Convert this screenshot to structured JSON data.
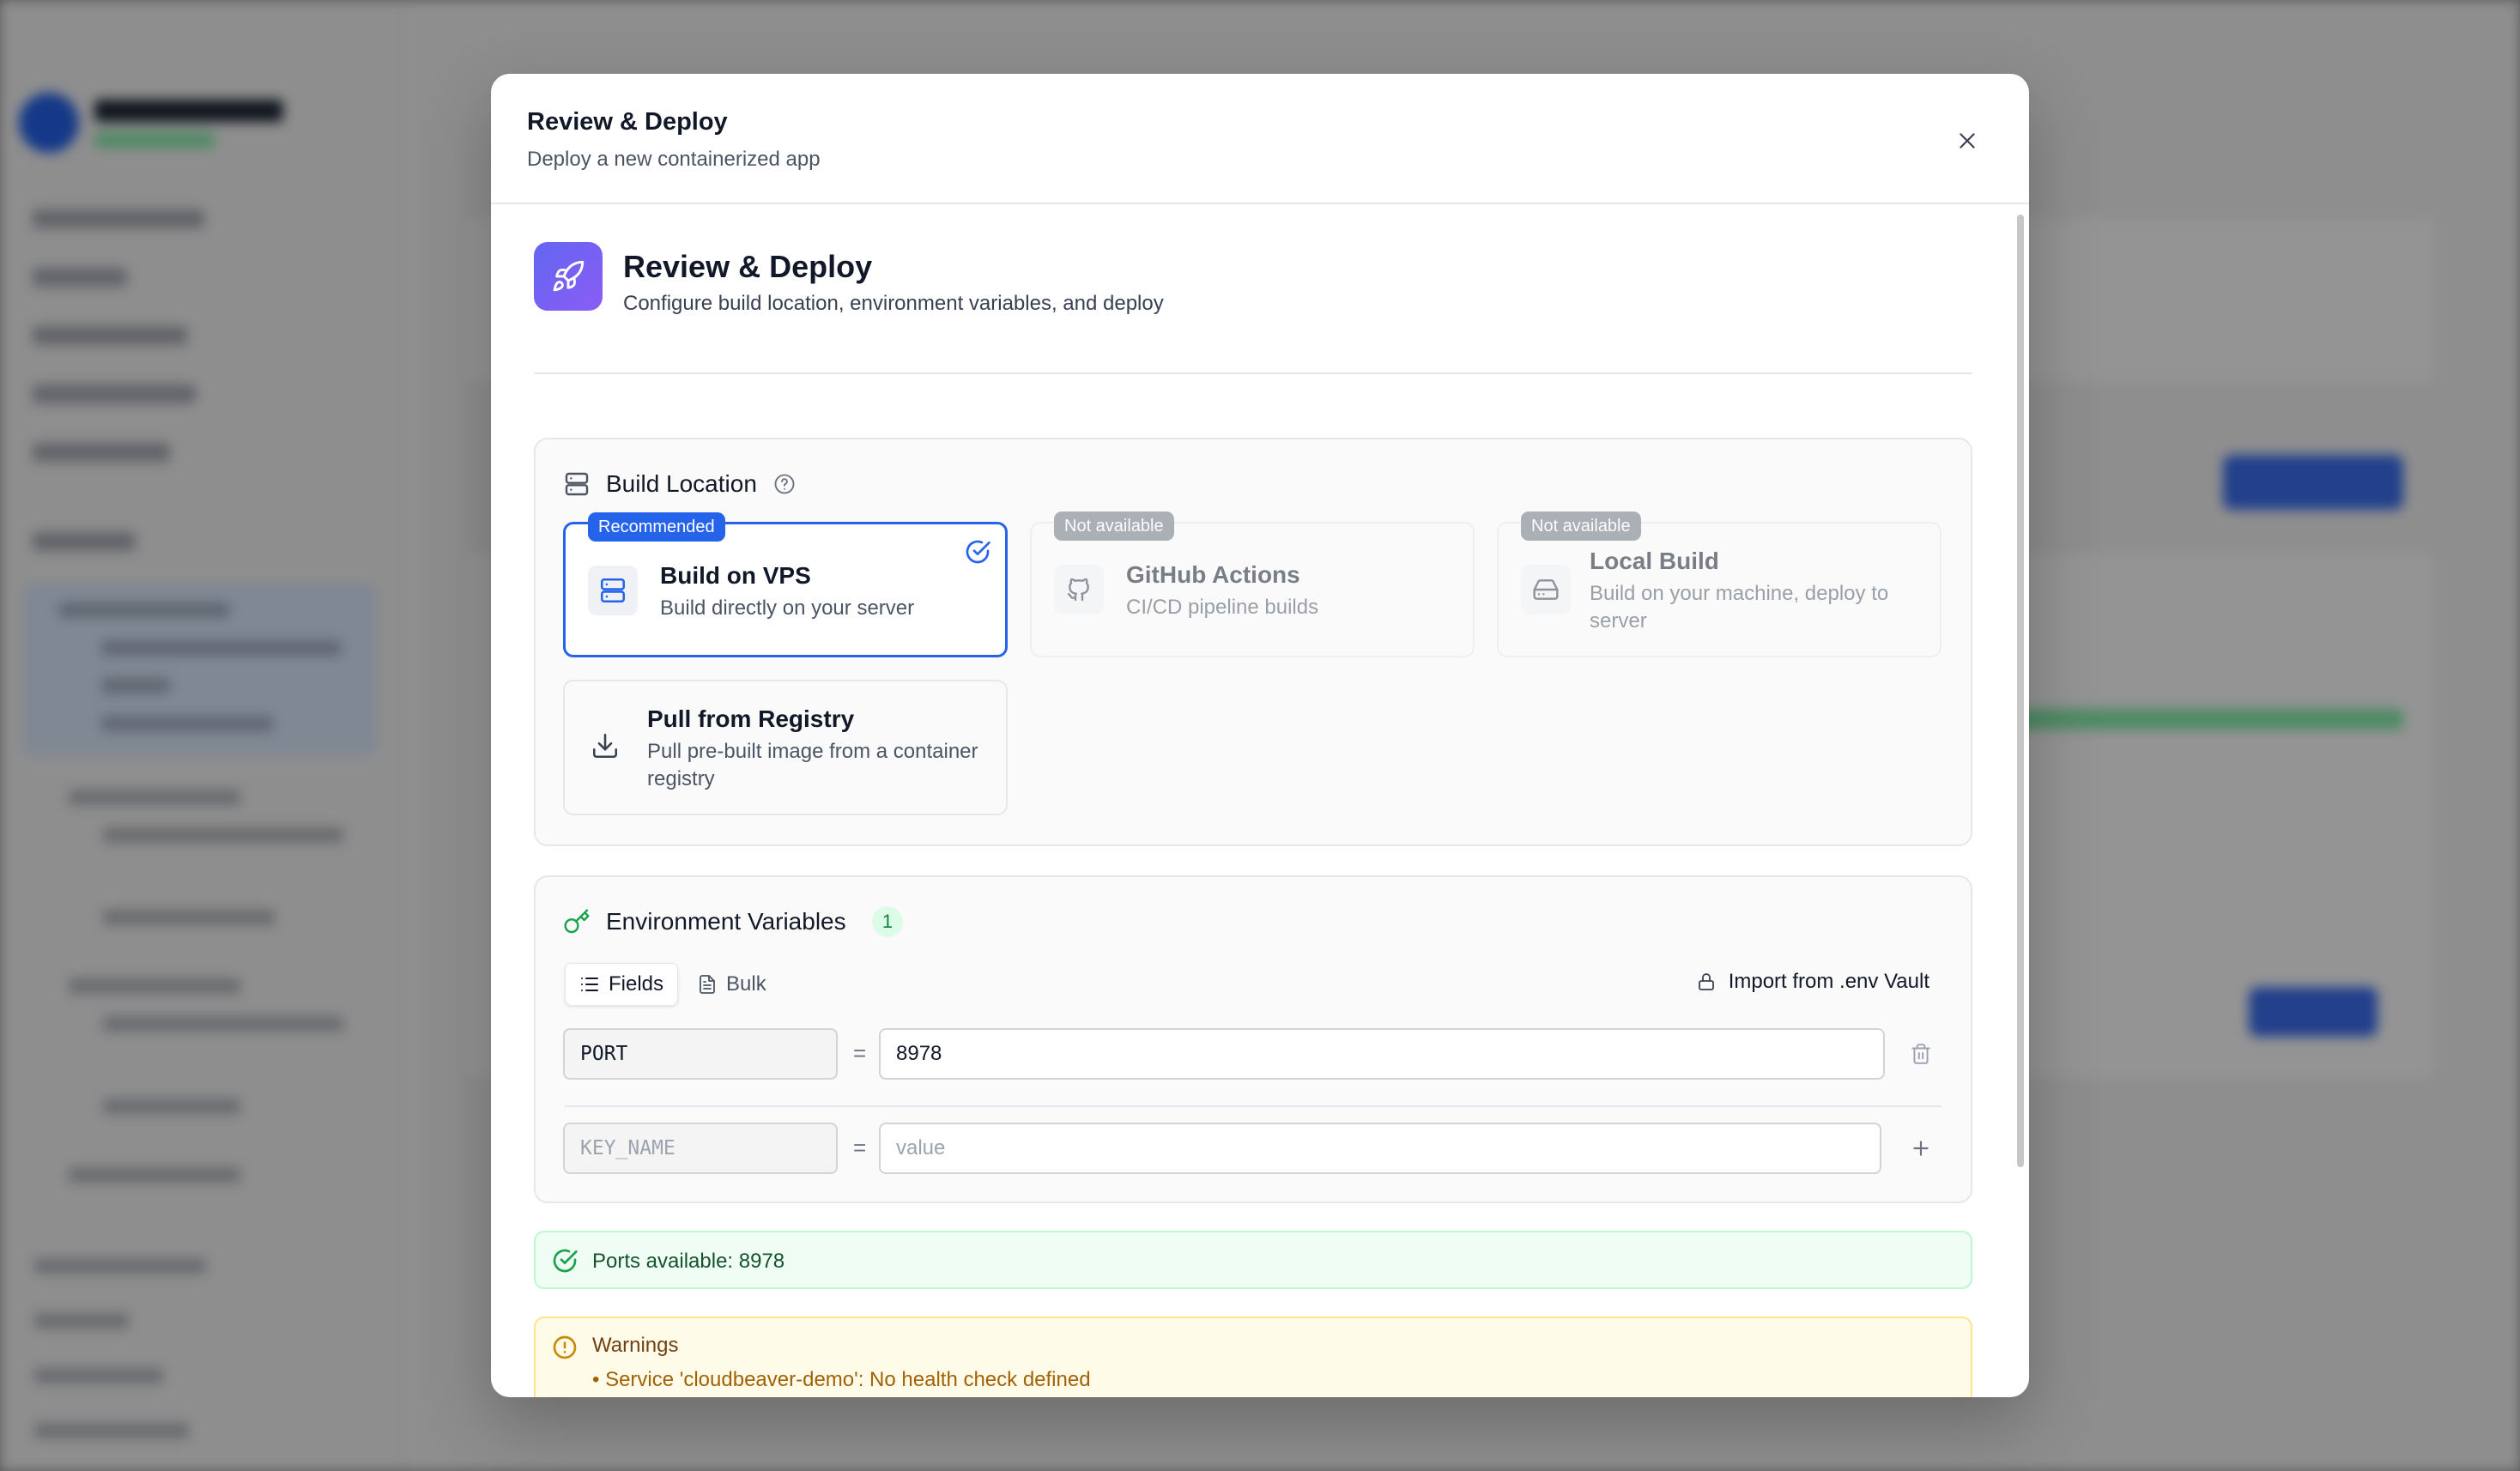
{
  "modal": {
    "title": "Review & Deploy",
    "subtitle": "Deploy a new containerized app"
  },
  "step": {
    "title": "Review & Deploy",
    "subtitle": "Configure build location, environment variables, and deploy"
  },
  "build_location": {
    "title": "Build Location",
    "options": [
      {
        "badge": "Recommended",
        "title": "Build on VPS",
        "desc": "Build directly on your server",
        "selected": true,
        "available": true,
        "icon": "server-icon"
      },
      {
        "badge": "Not available",
        "title": "GitHub Actions",
        "desc": "CI/CD pipeline builds",
        "selected": false,
        "available": false,
        "icon": "github-icon"
      },
      {
        "badge": "Not available",
        "title": "Local Build",
        "desc": "Build on your machine, deploy to server",
        "selected": false,
        "available": false,
        "icon": "hard-drive-icon"
      },
      {
        "badge": "",
        "title": "Pull from Registry",
        "desc": "Pull pre-built image from a container registry",
        "selected": false,
        "available": true,
        "icon": "download-icon"
      }
    ]
  },
  "env": {
    "title": "Environment Variables",
    "count": "1",
    "tabs": {
      "fields": "Fields",
      "bulk": "Bulk"
    },
    "import_label": "Import from .env Vault",
    "rows": [
      {
        "key": "PORT",
        "value": "8978"
      }
    ],
    "new_key_placeholder": "KEY_NAME",
    "new_value_placeholder": "value",
    "equals": "="
  },
  "ports_alert": {
    "text": "Ports available: 8978"
  },
  "warnings": {
    "title": "Warnings",
    "items": [
      "• Service 'cloudbeaver-demo': No health check defined"
    ]
  },
  "colors": {
    "accent": "#2563eb",
    "success": "#16a34a",
    "warning": "#a16207"
  }
}
